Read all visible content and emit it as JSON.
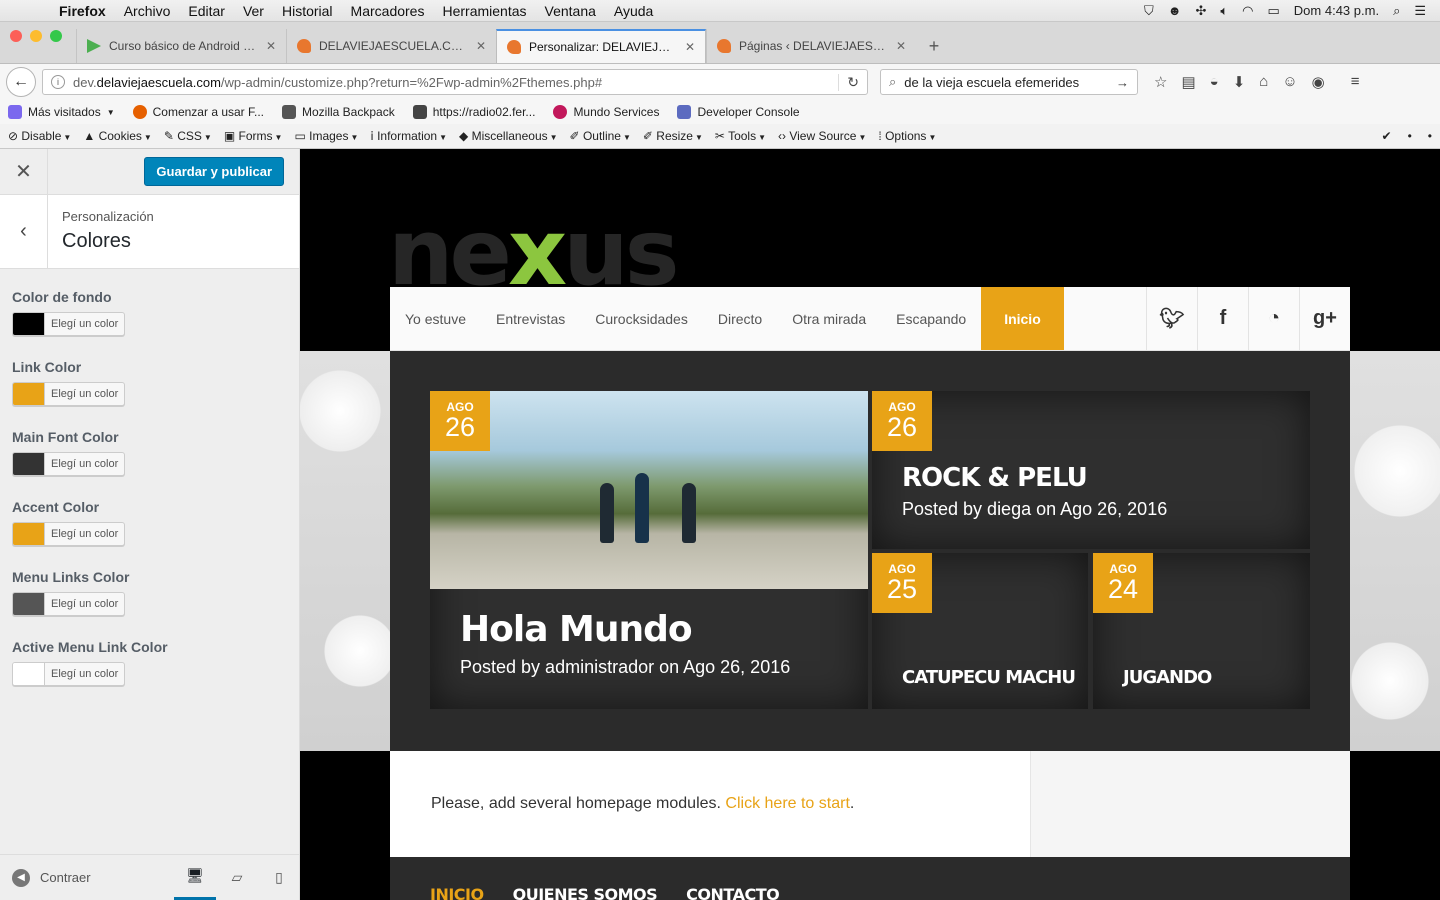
{
  "menubar": {
    "app": "Firefox",
    "items": [
      "Archivo",
      "Editar",
      "Ver",
      "Historial",
      "Marcadores",
      "Herramientas",
      "Ventana",
      "Ayuda"
    ],
    "clock": "Dom 4:43 p.m."
  },
  "tabs": [
    {
      "title": "Curso básico de Android | ...",
      "favicon_color": "#4caf50",
      "active": false
    },
    {
      "title": "DELAVIEJAESCUELA.COM",
      "favicon_color": "#e8772e",
      "active": false
    },
    {
      "title": "Personalizar: DELAVIEJAES...",
      "favicon_color": "#e8772e",
      "active": true
    },
    {
      "title": "Páginas ‹ DELAVIEJAESCU...",
      "favicon_color": "#e8772e",
      "active": false
    }
  ],
  "url": {
    "prefix": "dev.",
    "host": "delaviejaescuela.com",
    "path": "/wp-admin/customize.php?return=%2Fwp-admin%2Fthemes.php#"
  },
  "search": {
    "value": "de la vieja escuela efemerides"
  },
  "bookmarks": [
    {
      "label": "Más visitados",
      "color": "#7b68ee",
      "menu": true
    },
    {
      "label": "Comenzar a usar F...",
      "color": "#e66000",
      "menu": false
    },
    {
      "label": "Mozilla Backpack",
      "color": "#555555",
      "menu": false
    },
    {
      "label": "https://radio02.fer...",
      "color": "#444444",
      "menu": false
    },
    {
      "label": "Mundo Services",
      "color": "#c2185b",
      "menu": false
    },
    {
      "label": "Developer Console",
      "color": "#5c6bc0",
      "menu": false
    }
  ],
  "devtools": [
    "Disable",
    "Cookies",
    "CSS",
    "Forms",
    "Images",
    "Information",
    "Miscellaneous",
    "Outline",
    "Resize",
    "Tools",
    "View Source",
    "Options"
  ],
  "customizer": {
    "publish_label": "Guardar y publicar",
    "breadcrumb": "Personalización",
    "section_title": "Colores",
    "collapse_label": "Contraer",
    "controls": [
      {
        "label": "Color de fondo",
        "color": "#000000",
        "button": "Elegí un color"
      },
      {
        "label": "Link Color",
        "color": "#e8a317",
        "button": "Elegí un color"
      },
      {
        "label": "Main Font Color",
        "color": "#333333",
        "button": "Elegí un color"
      },
      {
        "label": "Accent Color",
        "color": "#e8a317",
        "button": "Elegí un color"
      },
      {
        "label": "Menu Links Color",
        "color": "#555555",
        "button": "Elegí un color"
      },
      {
        "label": "Active Menu Link Color",
        "color": "#ffffff",
        "button": "Elegí un color"
      }
    ]
  },
  "site": {
    "logo": {
      "pre": "ne",
      "x": "x",
      "post": "us"
    },
    "nav": [
      "Yo estuve",
      "Entrevistas",
      "Curocksidades",
      "Directo",
      "Otra mirada",
      "Escapando"
    ],
    "nav_active": "Inicio",
    "social": [
      "twitter-icon",
      "facebook-icon",
      "rss-icon",
      "google-plus-icon"
    ],
    "posts": [
      {
        "month": "AGO",
        "day": "26",
        "title": "Hola Mundo",
        "meta": "Posted by administrador on Ago 26, 2016"
      },
      {
        "month": "AGO",
        "day": "26",
        "title": "ROCK & PELU",
        "meta": "Posted by diega on Ago 26, 2016"
      },
      {
        "month": "AGO",
        "day": "25",
        "title": "CATUPECU MACHU"
      },
      {
        "month": "AGO",
        "day": "24",
        "title": "JUGANDO"
      }
    ],
    "notice": {
      "text": "Please, add several homepage modules. ",
      "link": "Click here to start",
      "end": "."
    },
    "footer": [
      "INICIO",
      "QUIENES SOMOS",
      "CONTACTO"
    ]
  },
  "colors": {
    "accent": "#e8a317",
    "wp_blue": "#0085ba"
  }
}
